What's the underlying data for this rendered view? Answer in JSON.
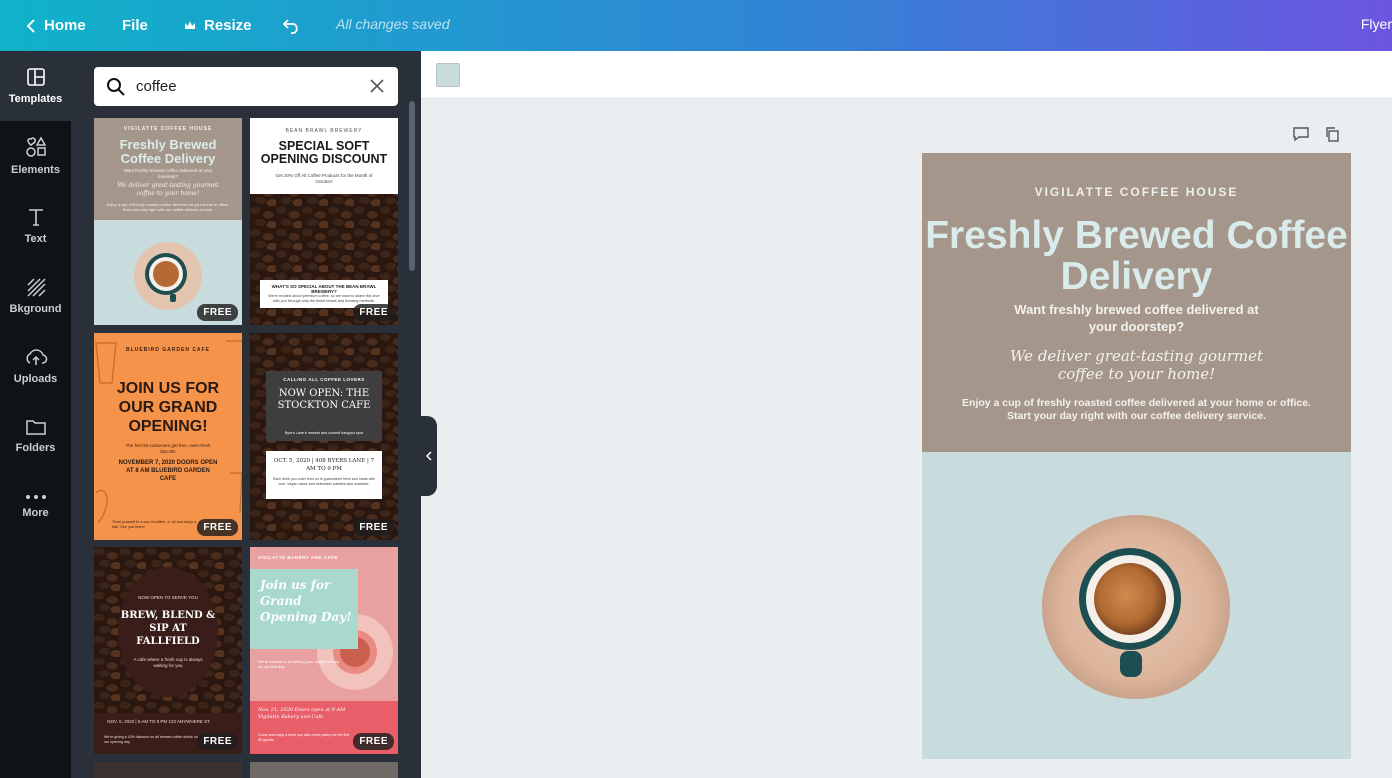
{
  "topbar": {
    "home": "Home",
    "file": "File",
    "resize": "Resize",
    "status": "All changes saved",
    "doc_type": "Flyer"
  },
  "rail": {
    "items": [
      {
        "label": "Templates",
        "icon": "templates-icon"
      },
      {
        "label": "Elements",
        "icon": "elements-icon"
      },
      {
        "label": "Text",
        "icon": "text-icon"
      },
      {
        "label": "Bkground",
        "icon": "background-icon"
      },
      {
        "label": "Uploads",
        "icon": "uploads-icon"
      },
      {
        "label": "Folders",
        "icon": "folder-icon"
      },
      {
        "label": "More",
        "icon": "more-icon"
      }
    ]
  },
  "search": {
    "value": "coffee"
  },
  "free_badge": "FREE",
  "templates": [
    {
      "t1": "VIGILATTE COFFEE HOUSE",
      "t2": "Freshly Brewed Coffee Delivery",
      "t3": "Want freshly brewed coffee delivered at your doorstep?",
      "t4": "We deliver great-tasting gourmet coffee to your home!",
      "t5": "Enjoy a cup of freshly roasted coffee delivered at your home or office. Start your day right with our coffee delivery service."
    },
    {
      "t1": "BEAN BRAWL BREWERY",
      "t2": "SPECIAL SOFT OPENING DISCOUNT",
      "t3": "Get 20% Off All Coffee Products for the Month of October!",
      "t4": "WHAT'S SO SPECIAL ABOUT THE BEAN BRAWL BREWERY?",
      "t5": "We're excited about premium coffee, so we want to share this love with you through only the finest beans and brewing methods."
    },
    {
      "t1": "BLUEBIRD GARDEN CAFE",
      "t2": "JOIN US FOR OUR GRAND OPENING!",
      "t3": "The first 50 customers get free, oven-fresh biscotti!",
      "t4": "NOVEMBER 7, 2020 DOORS OPEN AT 8 AM BLUEBIRD GARDEN CAFE",
      "t5": "Treat yourself to a cup of coffee, or sit and enjoy a bite. See you there!"
    },
    {
      "t1": "CALLING ALL COFFEE LOVERS",
      "t2": "NOW OPEN: THE STOCKTON CAFE",
      "t3": "Byers Lane's newest and coziest hangout spot",
      "t4": "OCT. 5, 2020 | 408 BYERS LANE | 7 AM TO 9 PM",
      "t5": "Each drink you order from us is guaranteed fresh and made with love. Vegan cakes and delectable pastries also available."
    },
    {
      "t1": "NOW OPEN TO SERVE YOU",
      "t2": "BREW, BLEND & SIP AT FALLFIELD",
      "t3": "A cafe where a fresh cup is always waiting for you",
      "t4": "NOV. 5, 2020 | 6 AM TO 9 PM 123 ANYWHERE ST.",
      "t5": "We're giving a 10% discount on all brewed coffee drinks on our opening day."
    },
    {
      "t1": "VIGILATTE BAKERY AND CAFE",
      "t2": "Join us for Grand Opening Day!",
      "t3": "We're excited to be joining your neighborhood on our first day.",
      "t4": "Nov. 21, 2020 Doors open at 9 AM Vigilatte Bakery and Cafe",
      "t5": "Come and enjoy a fresh cup with a free pastry for the first 50 guests."
    }
  ],
  "flyer": {
    "house": "VIGILATTE COFFEE HOUSE",
    "title": "Freshly Brewed Coffee Delivery",
    "subtitle": "Want freshly brewed coffee delivered at your doorstep?",
    "script": "We deliver great-tasting gourmet coffee to your home!",
    "body": "Enjoy a cup of freshly roasted coffee delivered at your home or office. Start your day right with our coffee delivery service."
  },
  "colors": {
    "flyer_top": "#a4968a",
    "flyer_bottom": "#c8dcdd",
    "swatch": "#c8dcdd",
    "panel": "#293039",
    "rail": "#0e1318"
  }
}
